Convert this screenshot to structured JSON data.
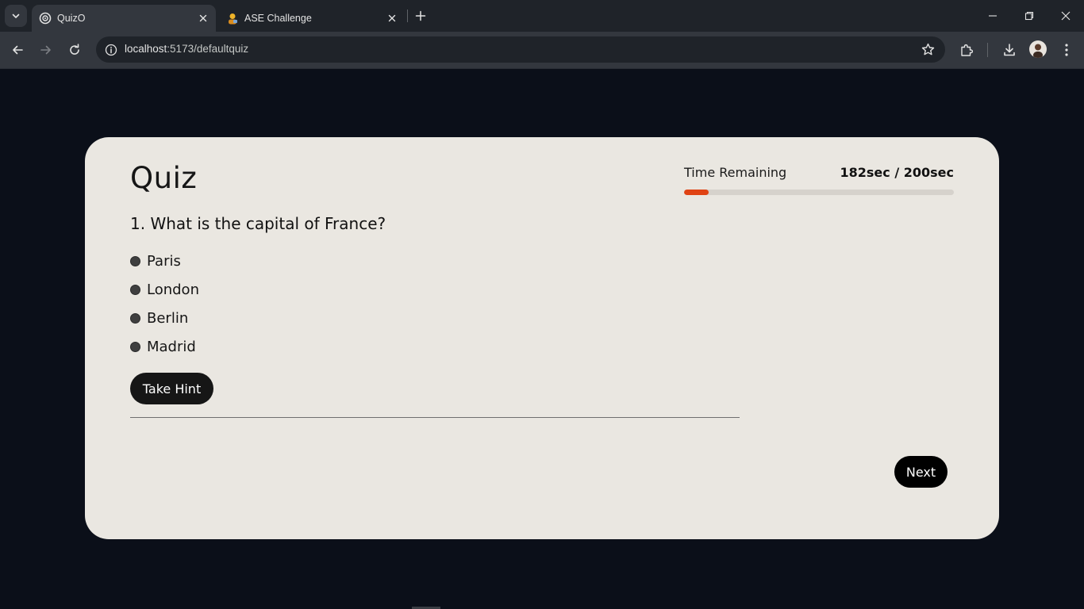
{
  "browser": {
    "tabs": [
      {
        "title": "QuizO",
        "icon": "quizo-favicon",
        "active": true
      },
      {
        "title": "ASE Challenge",
        "icon": "avatar-favicon",
        "active": false
      }
    ],
    "address_bar": {
      "host": "localhost",
      "path": ":5173/defaultquiz"
    }
  },
  "quiz": {
    "title": "Quiz",
    "timer": {
      "label": "Time Remaining",
      "value_text": "182sec / 200sec",
      "remaining_seconds": 182,
      "total_seconds": 200,
      "elapsed_fraction": 0.09
    },
    "question": "1. What is the capital of France?",
    "options": [
      "Paris",
      "London",
      "Berlin",
      "Madrid"
    ],
    "hint_button": "Take Hint",
    "next_button": "Next"
  },
  "colors": {
    "page_background": "#0b0f19",
    "card_background": "#eae7e1",
    "timer_fill": "#e04314",
    "button_background": "#161616"
  }
}
